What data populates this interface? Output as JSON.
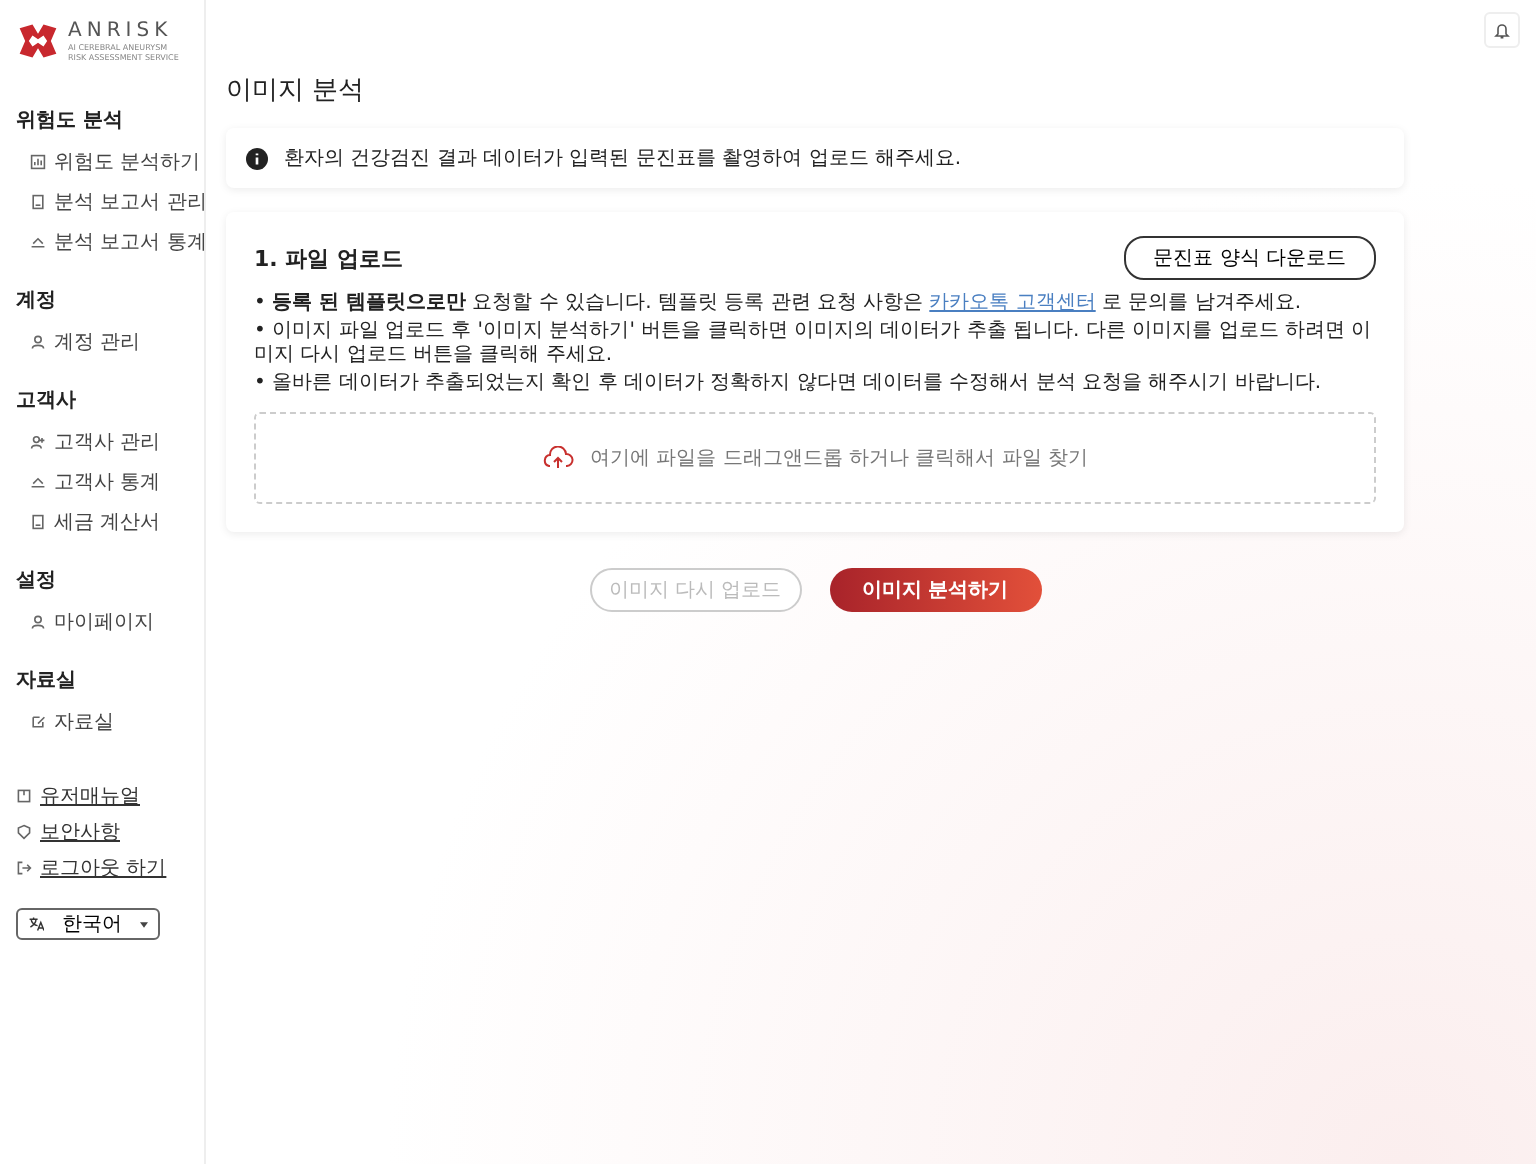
{
  "logo": {
    "name": "ANRISK",
    "tagline_1": "AI CEREBRAL ANEURYSM",
    "tagline_2": "RISK ASSESSMENT SERVICE"
  },
  "sidebar": {
    "sections": [
      {
        "title": "위험도 분석",
        "items": [
          {
            "label": "위험도 분석하기"
          },
          {
            "label": "분석 보고서 관리"
          },
          {
            "label": "분석 보고서 통계"
          }
        ]
      },
      {
        "title": "계정",
        "items": [
          {
            "label": "계정 관리"
          }
        ]
      },
      {
        "title": "고객사",
        "items": [
          {
            "label": "고객사 관리"
          },
          {
            "label": "고객사 통계"
          },
          {
            "label": "세금 계산서"
          }
        ]
      },
      {
        "title": "설정",
        "items": [
          {
            "label": "마이페이지"
          }
        ]
      },
      {
        "title": "자료실",
        "items": [
          {
            "label": "자료실"
          }
        ]
      }
    ],
    "footer_links": [
      {
        "label": "유저매뉴얼"
      },
      {
        "label": "보안사항"
      },
      {
        "label": "로그아웃 하기"
      }
    ],
    "language": "한국어"
  },
  "page_title": "이미지 분석",
  "notice": "환자의 건강검진 결과 데이터가 입력된 문진표를 촬영하여 업로드 해주세요.",
  "upload": {
    "title": "1. 파일 업로드",
    "download_button": "문진표 양식 다운로드",
    "bullets": [
      "• **등록 된 템플릿으로만** 요청할 수 있습니다. 템플릿 등록 관련 요청 사항은",
      "• 이미지 파일 업로드 후 '이미지 분석하기' 버튼을 클릭하면 이미지의 데이터가 추출 됩니다. 다른 이미지를 업로드 하려면 이미지 다시 업로드 버튼을 클릭해 주세요.",
      "• 올바른 데이터가 추출되었는지 확인 후 데이터가 정확하지 않다면 데이터를 수정해서 분석 요청을 해주시기 바랍니다."
    ],
    "link": "카카오톡 고객센터",
    "link_after": "로 문의를 남겨주세요.",
    "dropzone": "여기에 파일을 드래그앤드롭 하거나 클릭해서 파일 찾기"
  },
  "actions": [
    {
      "label": "이미지 다시 업로드",
      "disabled": true
    },
    {
      "label": "이미지 분석하기",
      "disabled": false
    }
  ]
}
